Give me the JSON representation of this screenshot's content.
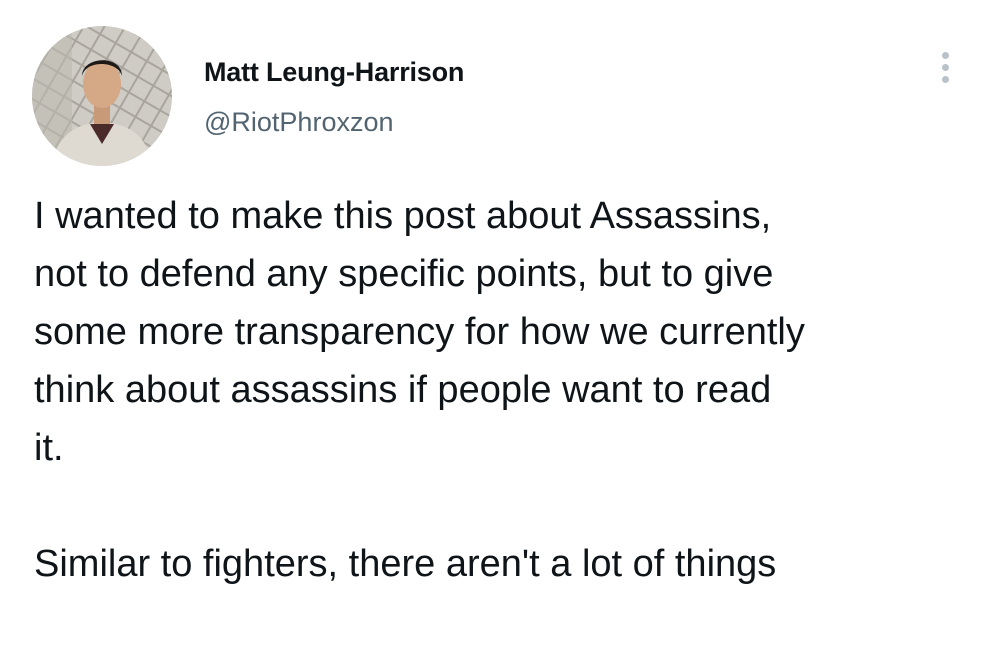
{
  "author": {
    "display_name": "Matt Leung-Harrison",
    "handle": "@RiotPhroxzon"
  },
  "icons": {
    "avatar": "profile-photo",
    "more": "more-vertical-icon"
  },
  "tweet": {
    "paragraph_1": "I wanted to make this post about Assassins,\nnot to defend any specific points, but to give\nsome more transparency for how we currently\nthink about assassins if people want to read\nit.",
    "paragraph_2": "Similar to fighters, there aren't a lot of things"
  }
}
